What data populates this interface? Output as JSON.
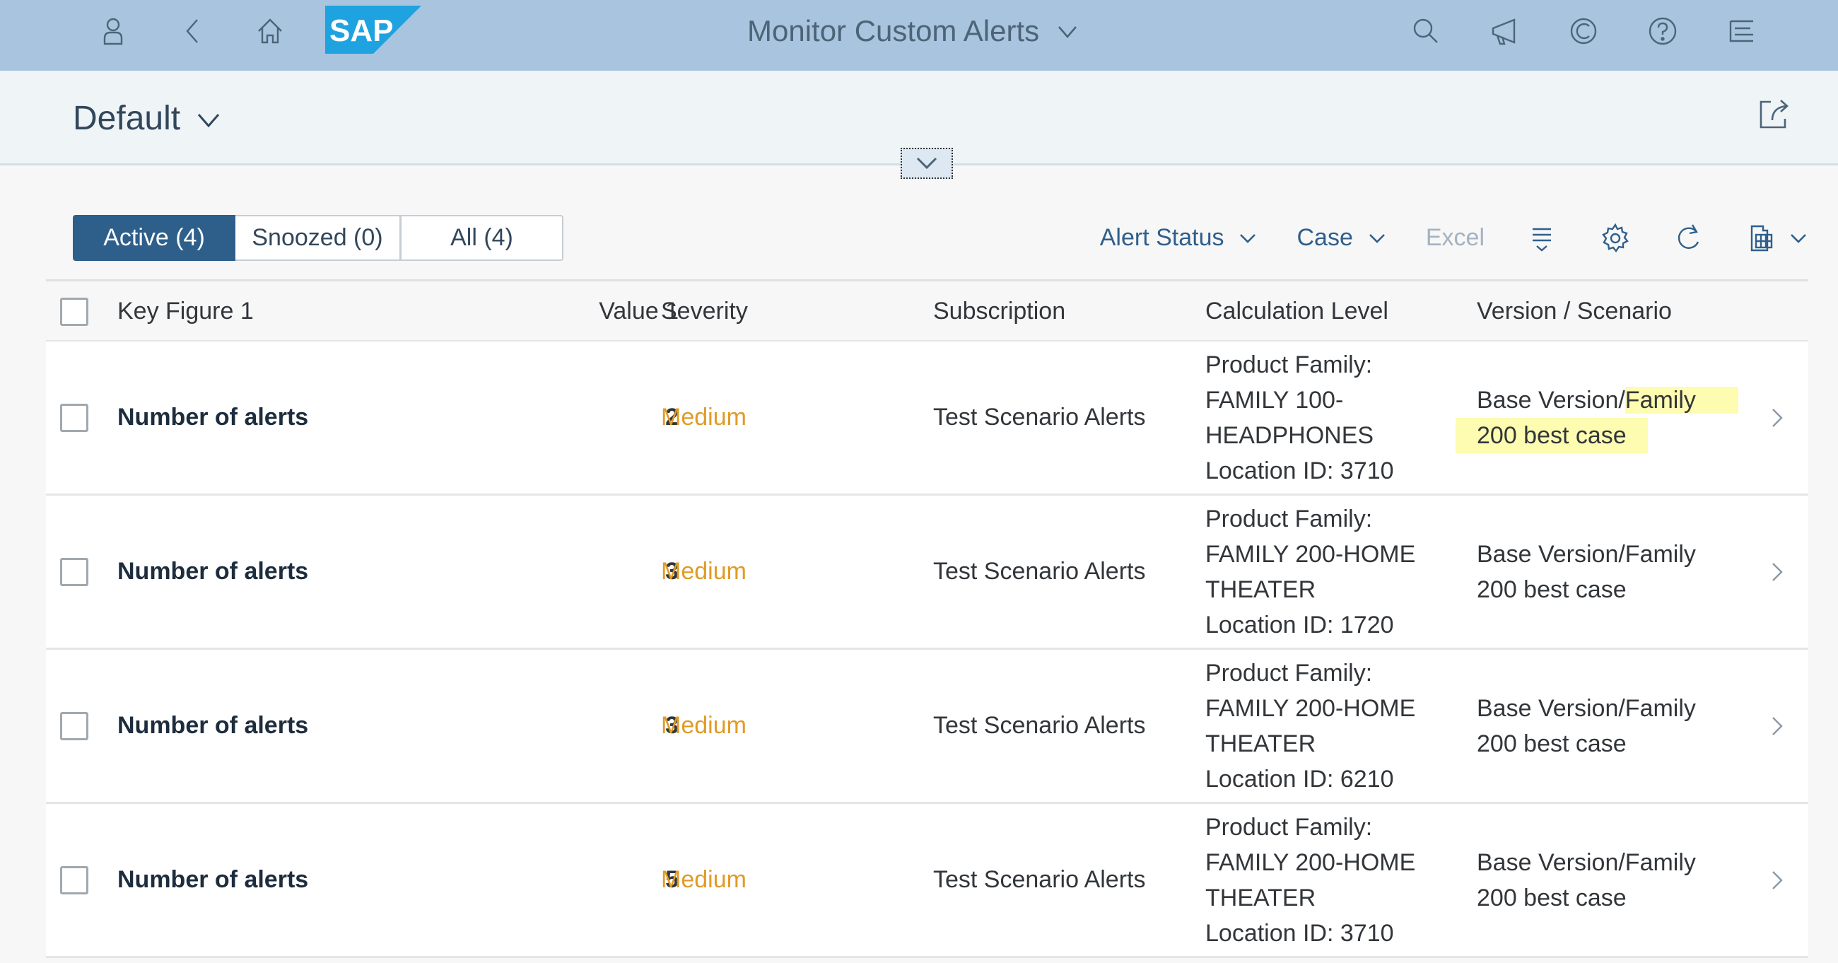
{
  "shell": {
    "title": "Monitor Custom Alerts",
    "logo_text": "SAP",
    "brand_color": "#1ea2e0",
    "icons": [
      "user-icon",
      "back-icon",
      "home-icon",
      "search-icon",
      "notifications-megaphone-icon",
      "copilot-icon",
      "help-icon",
      "menu-icon"
    ]
  },
  "header": {
    "variant": "Default"
  },
  "toolbar": {
    "tabs": [
      {
        "label": "Active (4)",
        "selected": true
      },
      {
        "label": "Snoozed (0)",
        "selected": false
      },
      {
        "label": "All (4)",
        "selected": false
      }
    ],
    "alert_status_label": "Alert Status",
    "case_label": "Case",
    "excel_label": "Excel"
  },
  "table": {
    "columns": [
      "Key Figure 1",
      "Value 1",
      "Severity",
      "Subscription",
      "Calculation Level",
      "Version / Scenario"
    ],
    "rows": [
      {
        "key_figure": "Number of alerts",
        "value": "2",
        "severity": "Medium",
        "subscription": "Test Scenario Alerts",
        "calc": [
          "Product Family:",
          "FAMILY 100-",
          "HEADPHONES",
          "Location ID: 3710"
        ],
        "version_a": "Base Version/",
        "version_b": "Family",
        "version_c": "200 best case",
        "highlighted": true
      },
      {
        "key_figure": "Number of alerts",
        "value": "3",
        "severity": "Medium",
        "subscription": "Test Scenario Alerts",
        "calc": [
          "Product Family:",
          "FAMILY 200-HOME",
          "THEATER",
          "Location ID: 1720"
        ],
        "version_a": "Base Version/",
        "version_b": "Family",
        "version_c": "200 best case",
        "highlighted": false
      },
      {
        "key_figure": "Number of alerts",
        "value": "3",
        "severity": "Medium",
        "subscription": "Test Scenario Alerts",
        "calc": [
          "Product Family:",
          "FAMILY 200-HOME",
          "THEATER",
          "Location ID: 6210"
        ],
        "version_a": "Base Version/",
        "version_b": "Family",
        "version_c": "200 best case",
        "highlighted": false
      },
      {
        "key_figure": "Number of alerts",
        "value": "5",
        "severity": "Medium",
        "subscription": "Test Scenario Alerts",
        "calc": [
          "Product Family:",
          "FAMILY 200-HOME",
          "THEATER",
          "Location ID: 3710"
        ],
        "version_a": "Base Version/",
        "version_b": "Family",
        "version_c": "200 best case",
        "highlighted": false
      }
    ]
  },
  "colors": {
    "shell_bg": "#a9c4de",
    "selected_tab": "#2d5f8a",
    "severity_medium": "#e09b26",
    "highlight": "#fdfcb0"
  }
}
